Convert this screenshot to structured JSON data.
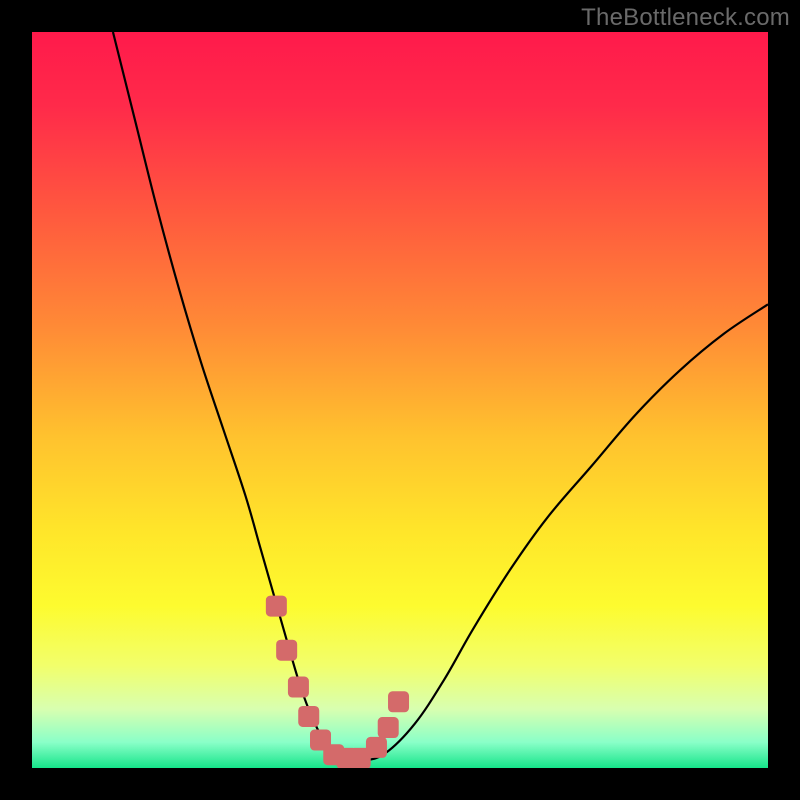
{
  "watermark": "TheBottleneck.com",
  "colors": {
    "frame": "#000000",
    "curve": "#000000",
    "marker_fill": "#d46a6a",
    "marker_stroke": "#d46a6a",
    "gradient_stops": [
      {
        "offset": 0.0,
        "color": "#ff1a4b"
      },
      {
        "offset": 0.1,
        "color": "#ff2a4a"
      },
      {
        "offset": 0.25,
        "color": "#ff5a3e"
      },
      {
        "offset": 0.4,
        "color": "#ff8a36"
      },
      {
        "offset": 0.55,
        "color": "#ffc22e"
      },
      {
        "offset": 0.68,
        "color": "#ffe62a"
      },
      {
        "offset": 0.78,
        "color": "#fdfb2f"
      },
      {
        "offset": 0.86,
        "color": "#f2ff6a"
      },
      {
        "offset": 0.92,
        "color": "#d8ffb0"
      },
      {
        "offset": 0.965,
        "color": "#8affc8"
      },
      {
        "offset": 1.0,
        "color": "#16e58a"
      }
    ]
  },
  "chart_data": {
    "type": "line",
    "title": "",
    "xlabel": "",
    "ylabel": "",
    "xlim": [
      0,
      100
    ],
    "ylim": [
      0,
      100
    ],
    "grid": false,
    "legend": false,
    "series": [
      {
        "name": "bottleneck-curve",
        "x": [
          11,
          14,
          17,
          20,
          23,
          26,
          29,
          31,
          33,
          35,
          36.5,
          38,
          39.5,
          41,
          43,
          45,
          48,
          52,
          56,
          60,
          65,
          70,
          76,
          82,
          88,
          94,
          100
        ],
        "y": [
          100,
          88,
          76,
          65,
          55,
          46,
          37,
          30,
          23,
          16,
          11,
          7,
          4,
          2,
          1,
          1,
          2,
          6,
          12,
          19,
          27,
          34,
          41,
          48,
          54,
          59,
          63
        ]
      }
    ],
    "markers": {
      "name": "highlighted-points",
      "x": [
        33.2,
        34.6,
        36.2,
        37.6,
        39.2,
        41.0,
        42.8,
        44.6,
        46.8,
        48.4,
        49.8
      ],
      "y": [
        22.0,
        16.0,
        11.0,
        7.0,
        3.8,
        1.8,
        1.3,
        1.3,
        2.8,
        5.5,
        9.0
      ]
    }
  }
}
